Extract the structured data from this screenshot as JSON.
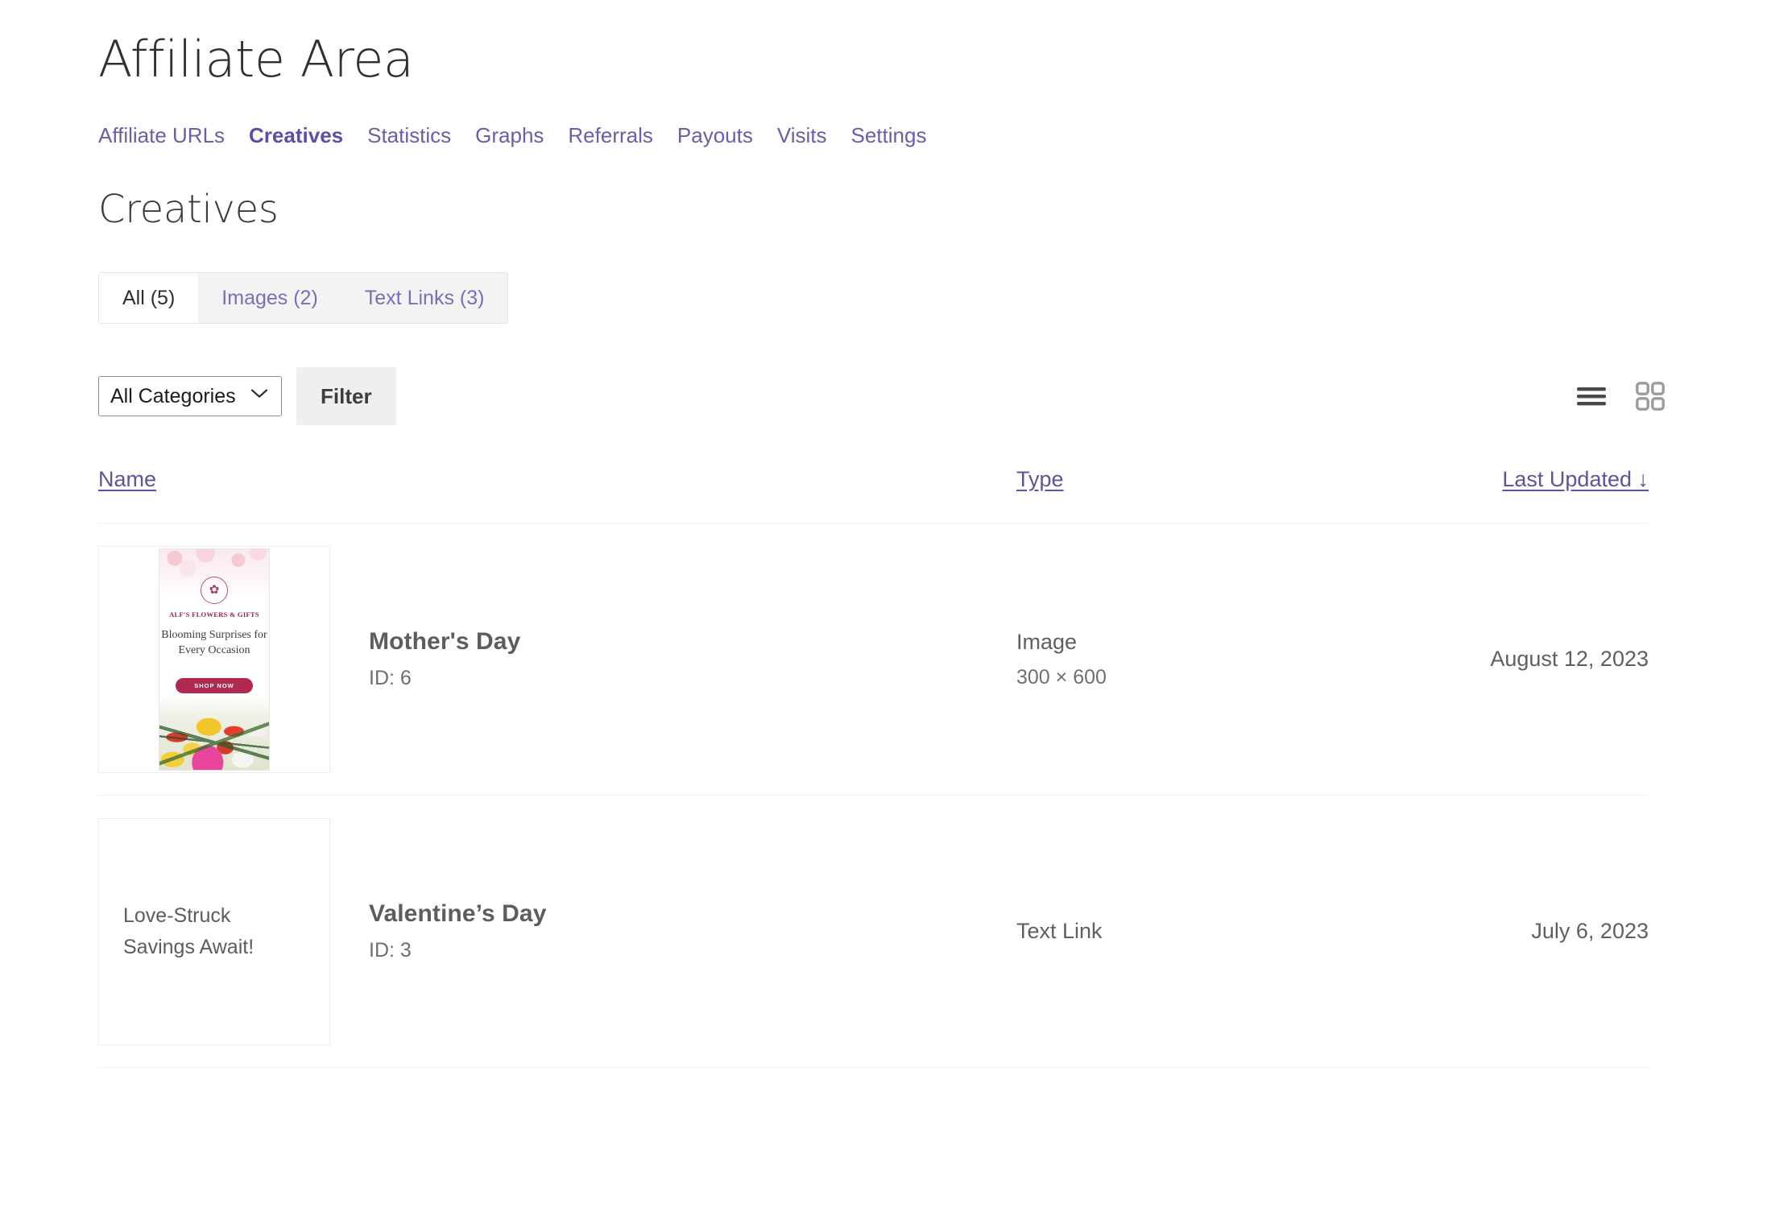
{
  "header": {
    "app_title": "Affiliate Area",
    "nav": [
      {
        "label": "Affiliate URLs",
        "active": false
      },
      {
        "label": "Creatives",
        "active": true
      },
      {
        "label": "Statistics",
        "active": false
      },
      {
        "label": "Graphs",
        "active": false
      },
      {
        "label": "Referrals",
        "active": false
      },
      {
        "label": "Payouts",
        "active": false
      },
      {
        "label": "Visits",
        "active": false
      },
      {
        "label": "Settings",
        "active": false
      }
    ]
  },
  "page": {
    "title": "Creatives"
  },
  "tabs": [
    {
      "label": "All (5)",
      "active": true
    },
    {
      "label": "Images (2)",
      "active": false
    },
    {
      "label": "Text Links (3)",
      "active": false
    }
  ],
  "filter": {
    "category_selected": "All Categories",
    "category_options": [
      "All Categories"
    ],
    "filter_button": "Filter",
    "caret_icon": "chevron-down-icon"
  },
  "view_toggle": {
    "list_icon": "list-view-icon",
    "grid_icon": "grid-view-icon",
    "active": "list"
  },
  "table": {
    "headers": {
      "name": "Name",
      "type": "Type",
      "last_updated": "Last Updated ↓"
    },
    "rows": [
      {
        "name": "Mother's Day",
        "id_label": "ID: 6",
        "type": "Image",
        "dimensions": "300 × 600",
        "last_updated": "August 12, 2023",
        "preview_kind": "image",
        "banner": {
          "brand": "ALF'S FLOWERS & GIFTS",
          "headline": "Blooming Surprises for Every Occasion",
          "cta": "SHOP NOW",
          "logo_icon": "flower-monogram-icon",
          "cta_color": "#b02a4f",
          "brand_color": "#8f2741"
        }
      },
      {
        "name": "Valentine’s Day",
        "id_label": "ID: 3",
        "type": "Text Link",
        "dimensions": "",
        "last_updated": "July 6, 2023",
        "preview_kind": "text",
        "preview_text": "Love-Struck Savings Await!"
      }
    ]
  },
  "colors": {
    "link_purple": "#6a5ea8",
    "text_dark": "#2f2f2f",
    "muted": "#5f5f5f",
    "tabbar_bg": "#f3f3f4",
    "button_bg": "#efefef"
  }
}
